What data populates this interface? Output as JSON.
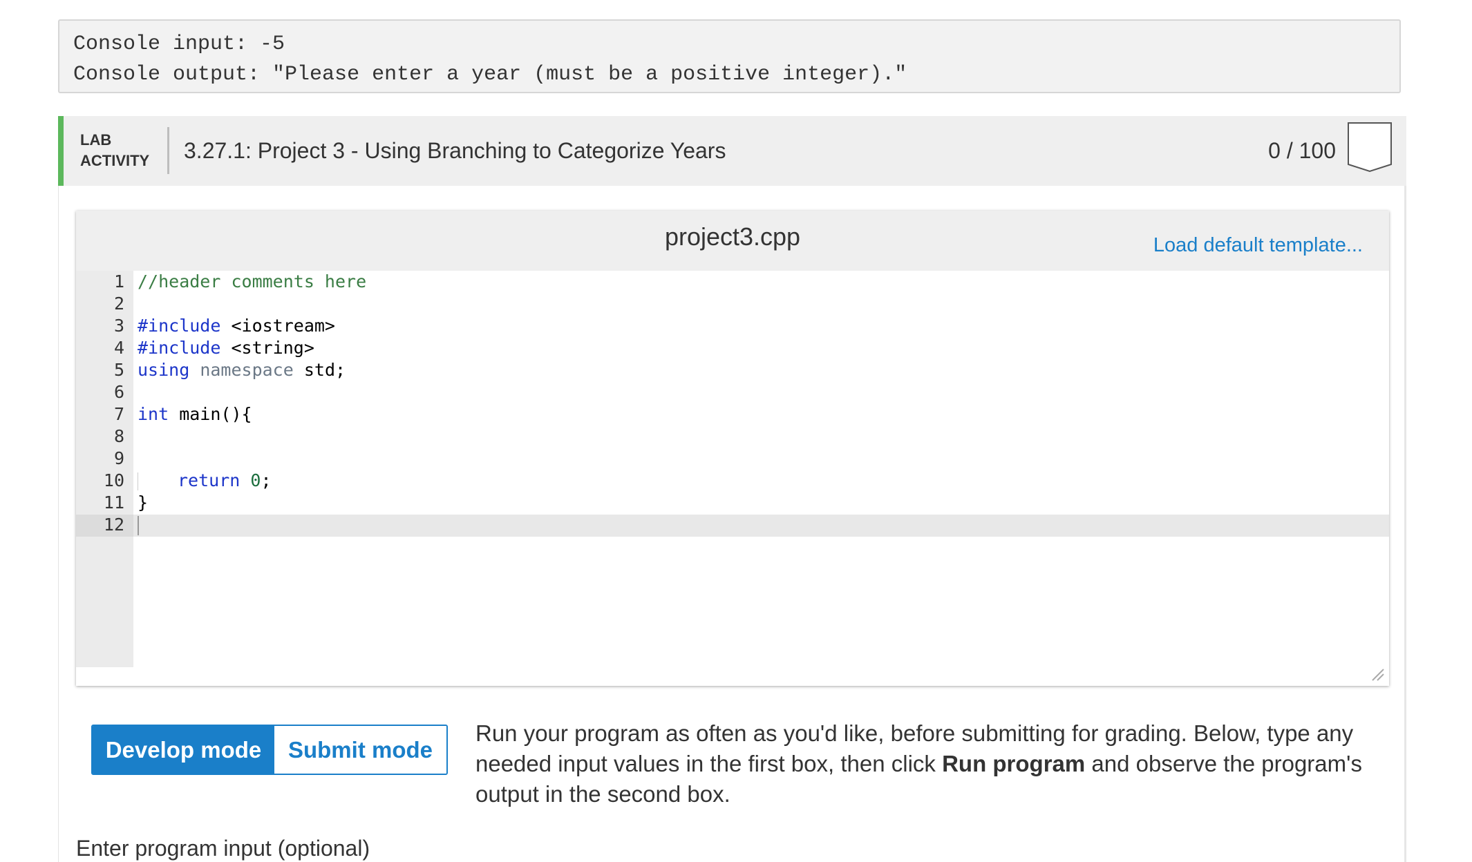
{
  "console": {
    "input_line": "Console input: -5",
    "output_line": "Console output: \"Please enter a year (must be a positive integer).\""
  },
  "lab": {
    "label_line1": "LAB",
    "label_line2": "ACTIVITY",
    "title": "3.27.1: Project 3 - Using Branching to Categorize Years",
    "score": "0 / 100",
    "accent_color": "#5cb85c"
  },
  "editor": {
    "filename": "project3.cpp",
    "load_template": "Load default template...",
    "lines": [
      {
        "n": "1",
        "parts": [
          [
            "c-comment",
            "//header comments here"
          ]
        ]
      },
      {
        "n": "2",
        "parts": []
      },
      {
        "n": "3",
        "parts": [
          [
            "c-kw",
            "#include"
          ],
          [
            "",
            " <iostream>"
          ]
        ]
      },
      {
        "n": "4",
        "parts": [
          [
            "c-kw",
            "#include"
          ],
          [
            "",
            " <string>"
          ]
        ]
      },
      {
        "n": "5",
        "parts": [
          [
            "c-kw",
            "using"
          ],
          [
            "",
            " "
          ],
          [
            "c-ns",
            "namespace"
          ],
          [
            "",
            " std;"
          ]
        ]
      },
      {
        "n": "6",
        "parts": []
      },
      {
        "n": "7",
        "parts": [
          [
            "c-kw",
            "int"
          ],
          [
            "",
            " main(){"
          ]
        ]
      },
      {
        "n": "8",
        "parts": []
      },
      {
        "n": "9",
        "parts": []
      },
      {
        "n": "10",
        "parts": [
          [
            "guide",
            ""
          ],
          [
            "c-kw",
            "return"
          ],
          [
            "",
            " "
          ],
          [
            "c-num",
            "0"
          ],
          [
            "",
            ";"
          ]
        ]
      },
      {
        "n": "11",
        "parts": [
          [
            "",
            "}"
          ]
        ]
      },
      {
        "n": "12",
        "parts": [
          [
            "cursor",
            ""
          ]
        ]
      }
    ]
  },
  "modes": {
    "develop_label": "Develop mode",
    "submit_label": "Submit mode",
    "active": "Develop mode",
    "accent_color": "#1a7fc9"
  },
  "description": {
    "before": "Run your program as often as you'd like, before submitting for grading. Below, type any needed input values in the first box, then click ",
    "bold": "Run program",
    "after": " and observe the program's output in the second box."
  },
  "input_section": {
    "label": "Enter program input (optional)"
  }
}
